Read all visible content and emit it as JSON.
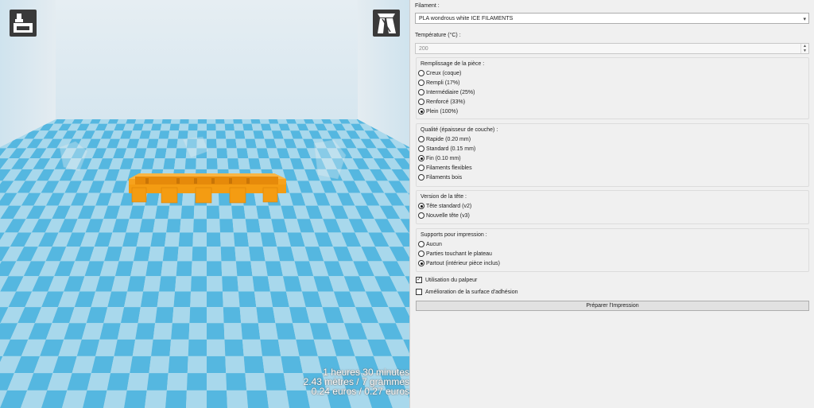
{
  "viewport": {
    "stats": {
      "line1": "1 heures 30 minutes",
      "line2": "2.43 mètres / 7 grammes",
      "line3": "0.24 euros / 0.27 euros"
    },
    "colors": {
      "grid_light": "#a8d8ec",
      "grid_dark": "#55b7e0",
      "model": "#f49c12",
      "button_bg": "#3a3a3a"
    },
    "left_button_icon": "print-tray-icon",
    "right_button_icon": "view-perspective-icon"
  },
  "panel": {
    "filament_label": "Filament :",
    "filament_value": "PLA wondrous white ICE FILAMENTS",
    "temperature_label": "Température (°C) :",
    "temperature_value": "200",
    "infill": {
      "title": "Remplissage de la pièce :",
      "options": [
        "Creux (coque)",
        "Rempli (17%)",
        "Intermédiaire (25%)",
        "Renforcé (33%)",
        "Plein (100%)"
      ],
      "selected": 4
    },
    "quality": {
      "title": "Qualité (épaisseur de couche) :",
      "options": [
        "Rapide (0.20 mm)",
        "Standard (0.15 mm)",
        "Fin (0.10 mm)",
        "Filaments flexibles",
        "Filaments bois"
      ],
      "selected": 2
    },
    "head": {
      "title": "Version de la tête :",
      "options": [
        "Tête standard (v2)",
        "Nouvelle tête (v3)"
      ],
      "selected": 0
    },
    "supports": {
      "title": "Supports pour impression :",
      "options": [
        "Aucun",
        "Parties touchant le plateau",
        "Partout (intérieur pièce inclus)"
      ],
      "selected": 2
    },
    "probe_label": "Utilisation du palpeur",
    "probe_checked": true,
    "adhesion_label": "Amélioration de la surface d'adhésion",
    "adhesion_checked": false,
    "prepare_label": "Préparer l'Impression"
  }
}
